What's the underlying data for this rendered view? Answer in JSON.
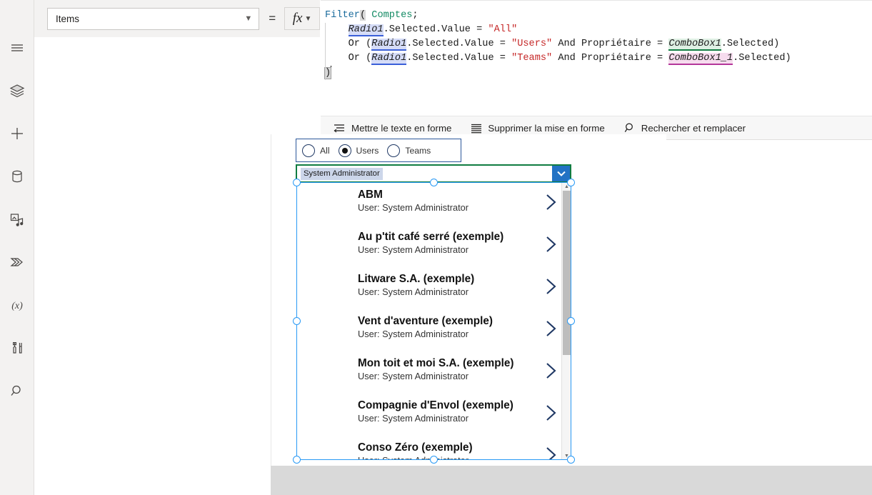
{
  "sidebar": {
    "items": [
      {
        "name": "menu-icon",
        "label": "Menu"
      },
      {
        "name": "tree-view-icon",
        "label": "Tree view"
      },
      {
        "name": "insert-icon",
        "label": "Insert"
      },
      {
        "name": "data-icon",
        "label": "Data"
      },
      {
        "name": "media-icon",
        "label": "Media"
      },
      {
        "name": "power-automate-icon",
        "label": "Power Automate"
      },
      {
        "name": "variables-icon",
        "label": "Variables"
      },
      {
        "name": "tools-icon",
        "label": "Tools"
      },
      {
        "name": "search-icon",
        "label": "Search"
      }
    ]
  },
  "formula_bar": {
    "property": "Items",
    "equals": "=",
    "fx_label": "fx",
    "code_lines": [
      [
        {
          "t": "Filter",
          "c": "tok-fn"
        },
        {
          "t": "(",
          "c": "paren-hi"
        },
        {
          "t": " ",
          "c": "tok-plain"
        },
        {
          "t": "Comptes",
          "c": "tok-table"
        },
        {
          "t": ";",
          "c": "tok-plain"
        }
      ],
      [
        {
          "t": "    ",
          "c": "tok-plain"
        },
        {
          "t": "Radio1",
          "c": "tok-ctrl hl-blue"
        },
        {
          "t": ".Selected.Value = ",
          "c": "tok-plain"
        },
        {
          "t": "\"All\"",
          "c": "tok-str"
        }
      ],
      [
        {
          "t": "    ",
          "c": "tok-plain"
        },
        {
          "t": "Or (",
          "c": "tok-plain"
        },
        {
          "t": "Radio1",
          "c": "tok-ctrl hl-blue"
        },
        {
          "t": ".Selected.Value = ",
          "c": "tok-plain"
        },
        {
          "t": "\"Users\"",
          "c": "tok-str"
        },
        {
          "t": " And Propriétaire = ",
          "c": "tok-plain"
        },
        {
          "t": "ComboBox1",
          "c": "tok-ctrl hl-green"
        },
        {
          "t": ".Selected)",
          "c": "tok-plain"
        }
      ],
      [
        {
          "t": "    ",
          "c": "tok-plain"
        },
        {
          "t": "Or (",
          "c": "tok-plain"
        },
        {
          "t": "Radio1",
          "c": "tok-ctrl hl-blue"
        },
        {
          "t": ".Selected.Value = ",
          "c": "tok-plain"
        },
        {
          "t": "\"Teams\"",
          "c": "tok-str"
        },
        {
          "t": " And Propriétaire = ",
          "c": "tok-plain"
        },
        {
          "t": "ComboBox1_1",
          "c": "tok-ctrl hl-pink"
        },
        {
          "t": ".Selected)",
          "c": "tok-plain"
        }
      ],
      [
        {
          "t": ")",
          "c": "paren-match"
        }
      ]
    ]
  },
  "formula_toolbar": {
    "format_text": "Mettre le texte en forme",
    "remove_formatting": "Supprimer la mise en forme",
    "find_replace": "Rechercher et remplacer"
  },
  "canvas": {
    "radio": {
      "options": [
        {
          "label": "All",
          "selected": false
        },
        {
          "label": "Users",
          "selected": true
        },
        {
          "label": "Teams",
          "selected": false
        }
      ]
    },
    "combobox": {
      "selected_chip": "System Administrator"
    },
    "gallery": {
      "items": [
        {
          "title": "ABM",
          "subtitle": "User: System Administrator"
        },
        {
          "title": "Au p'tit café serré (exemple)",
          "subtitle": "User: System Administrator"
        },
        {
          "title": "Litware S.A. (exemple)",
          "subtitle": "User: System Administrator"
        },
        {
          "title": "Vent d'aventure (exemple)",
          "subtitle": "User: System Administrator"
        },
        {
          "title": "Mon toit et moi S.A. (exemple)",
          "subtitle": "User: System Administrator"
        },
        {
          "title": "Compagnie d'Envol (exemple)",
          "subtitle": "User: System Administrator"
        },
        {
          "title": "Conso Zéro (exemple)",
          "subtitle": "User: System Administrator"
        }
      ]
    }
  },
  "colors": {
    "accent_blue": "#2899f5",
    "combo_green": "#107c41",
    "radio_border": "#2b579a",
    "chip_blue": "#ccd6ea",
    "highlight_blue": "#d5dcf7",
    "highlight_green": "#dff0e4",
    "highlight_pink": "#f6dcee"
  }
}
